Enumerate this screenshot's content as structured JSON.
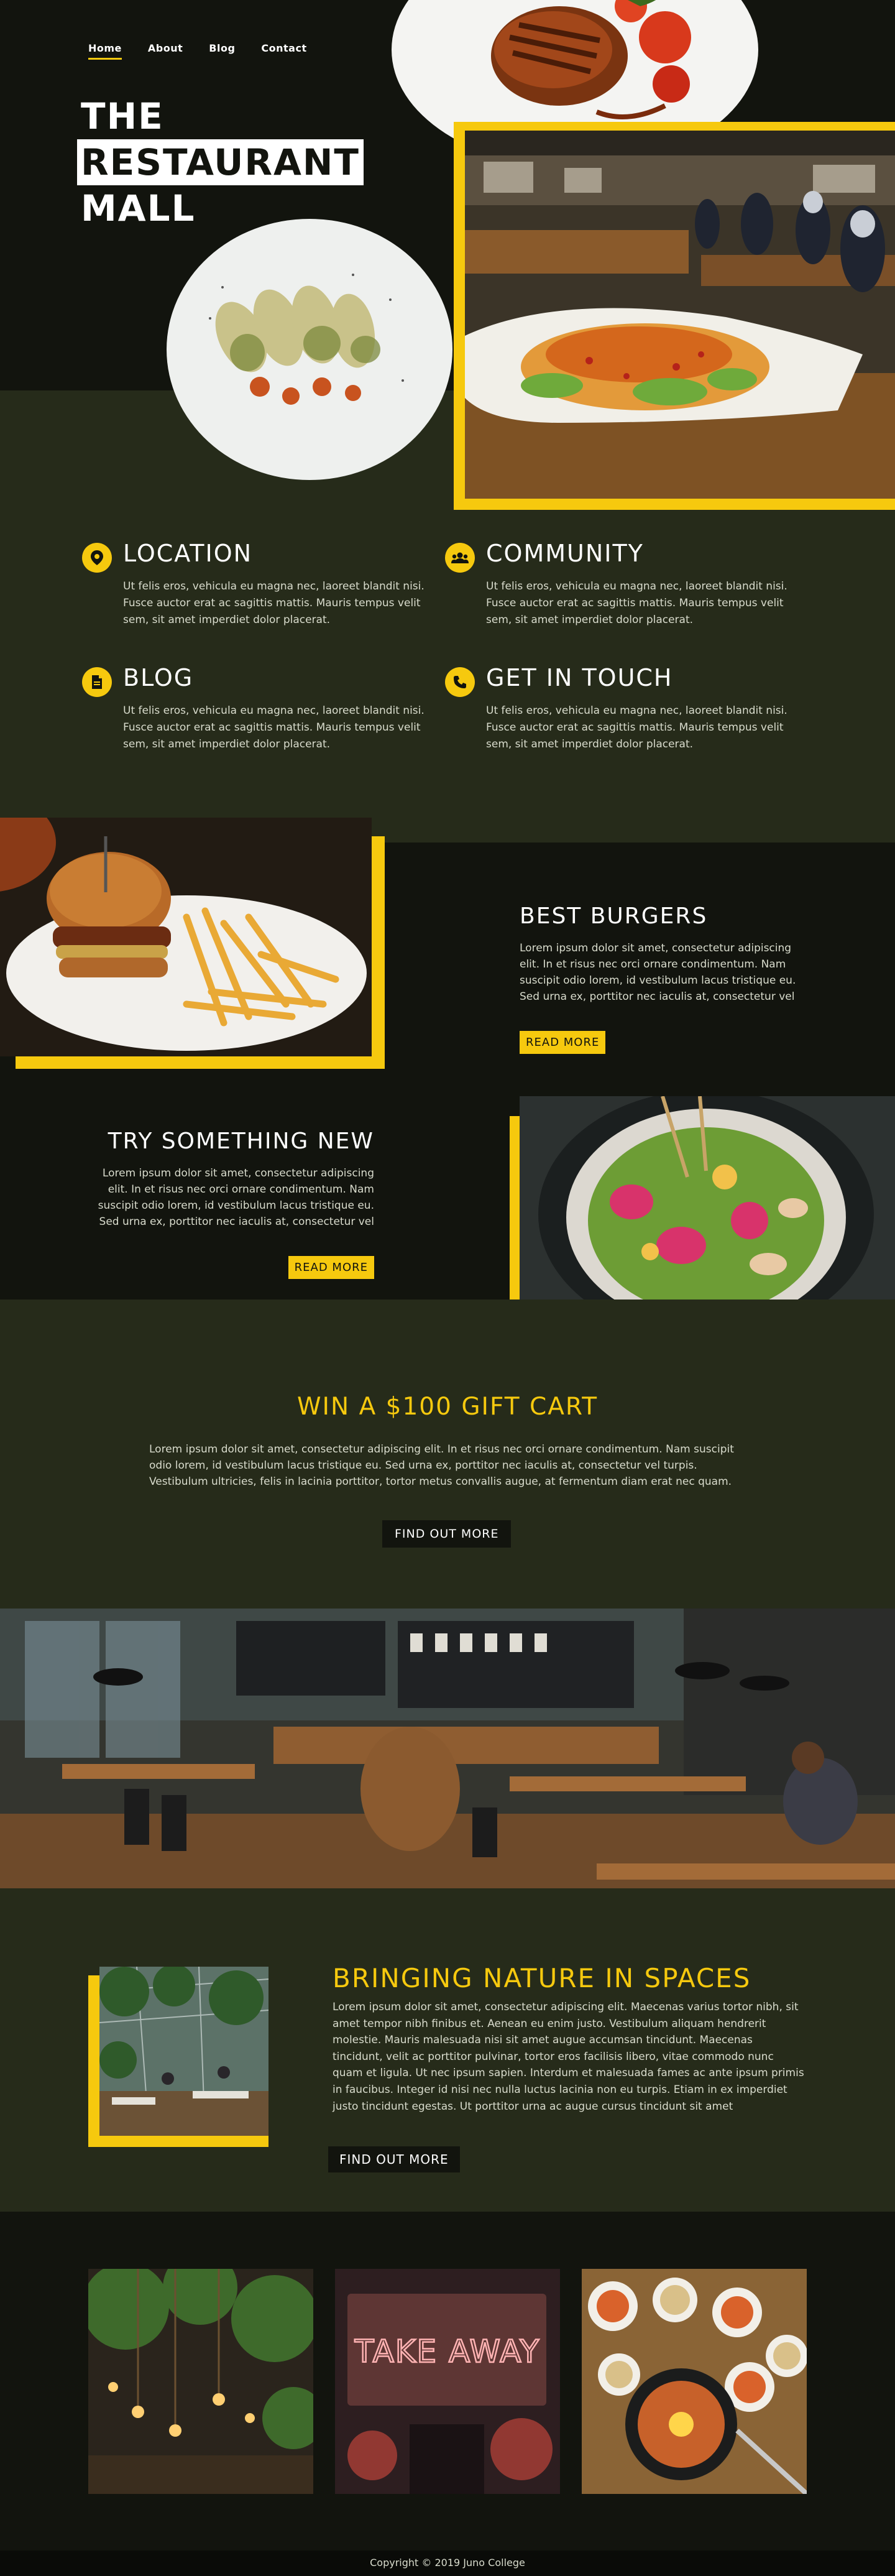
{
  "nav": {
    "items": [
      {
        "label": "Home",
        "active": true
      },
      {
        "label": "About",
        "active": false
      },
      {
        "label": "Blog",
        "active": false
      },
      {
        "label": "Contact",
        "active": false
      }
    ]
  },
  "hero": {
    "title_lines": [
      "THE",
      "RESTAURANT",
      "MALL"
    ]
  },
  "info": {
    "items": [
      {
        "icon": "location-pin-icon",
        "title": "LOCATION",
        "text": "Ut felis eros, vehicula eu magna nec, laoreet blandit nisi. Fusce auctor erat ac sagittis mattis. Mauris tempus velit sem, sit amet imperdiet dolor placerat."
      },
      {
        "icon": "community-icon",
        "title": "COMMUNITY",
        "text": "Ut felis eros, vehicula eu magna nec, laoreet blandit nisi. Fusce auctor erat ac sagittis mattis. Mauris tempus velit sem, sit amet imperdiet dolor placerat."
      },
      {
        "icon": "document-icon",
        "title": "BLOG",
        "text": "Ut felis eros, vehicula eu magna nec, laoreet blandit nisi. Fusce auctor erat ac sagittis mattis. Mauris tempus velit sem, sit amet imperdiet dolor placerat."
      },
      {
        "icon": "phone-icon",
        "title": "GET IN TOUCH",
        "text": "Ut felis eros, vehicula eu magna nec, laoreet blandit nisi. Fusce auctor erat ac sagittis mattis. Mauris tempus velit sem, sit amet imperdiet dolor placerat."
      }
    ]
  },
  "features": {
    "burgers": {
      "title": "BEST BURGERS",
      "text": "Lorem ipsum dolor sit amet, consectetur adipiscing elit. In et risus nec orci ornare condimentum. Nam suscipit odio lorem, id vestibulum lacus tristique eu. Sed urna ex, porttitor nec iaculis at, consectetur vel",
      "button": "READ MORE"
    },
    "new": {
      "title": "TRY SOMETHING NEW",
      "text": "Lorem ipsum dolor sit amet, consectetur adipiscing elit. In et risus nec orci ornare condimentum. Nam suscipit odio lorem, id vestibulum lacus tristique eu. Sed urna ex, porttitor nec iaculis at, consectetur vel",
      "button": "READ MORE"
    }
  },
  "gift": {
    "title": "WIN A $100 GIFT CART",
    "text": "Lorem ipsum dolor sit amet, consectetur adipiscing elit. In et risus nec orci ornare condimentum. Nam suscipit odio lorem, id vestibulum lacus tristique eu. Sed urna ex, porttitor nec iaculis at, consectetur vel turpis. Vestibulum ultricies, felis in lacinia porttitor, tortor metus convallis augue, at fermentum diam erat nec quam.",
    "button": "FIND OUT MORE"
  },
  "nature": {
    "title": "BRINGING NATURE IN SPACES",
    "text": "Lorem ipsum dolor sit amet, consectetur adipiscing elit. Maecenas varius tortor nibh, sit amet tempor nibh finibus et. Aenean eu enim justo. Vestibulum aliquam hendrerit molestie. Mauris malesuada nisi sit amet augue accumsan tincidunt. Maecenas tincidunt, velit ac porttitor pulvinar, tortor eros facilisis libero, vitae commodo nunc quam et ligula. Ut nec ipsum sapien. Interdum et malesuada fames ac ante ipsum primis in faucibus. Integer id nisi nec nulla luctus lacinia non eu turpis. Etiam in ex imperdiet justo tincidunt egestas. Ut porttitor urna ac augue cursus tincidunt sit amet",
    "button": "FIND OUT MORE"
  },
  "gallery": {
    "neon_sign": "TAKE AWAY"
  },
  "footer": {
    "copyright": "Copyright © 2019 Juno College"
  },
  "colors": {
    "accent": "#f6c90e",
    "dark": "#12140e",
    "olive": "#262b1a"
  }
}
